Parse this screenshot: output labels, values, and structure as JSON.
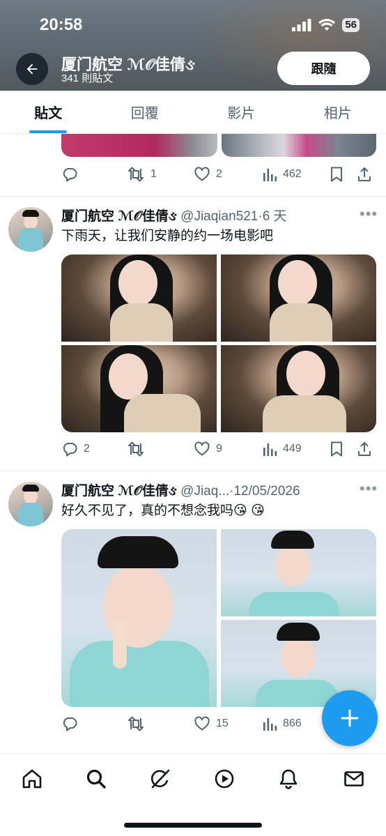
{
  "status_bar": {
    "time": "20:58",
    "battery": "56"
  },
  "header": {
    "name": "厦门航空 ℳ𝒪佳倩ઙ",
    "post_count": "341 則貼文",
    "follow_label": "跟隨"
  },
  "tabs": [
    {
      "label": "貼文",
      "active": true
    },
    {
      "label": "回覆",
      "active": false
    },
    {
      "label": "影片",
      "active": false
    },
    {
      "label": "相片",
      "active": false
    }
  ],
  "tweets": [
    {
      "stats": {
        "replies": "",
        "retweets": "1",
        "likes": "2",
        "views": "462"
      }
    },
    {
      "name": "厦门航空 ℳ𝒪佳倩ઙ",
      "handle": "@Jiaqian521",
      "separator": "·",
      "time": "6 天",
      "text": "下雨天，让我们安静的约一场电影吧",
      "stats": {
        "replies": "2",
        "retweets": "",
        "likes": "9",
        "views": "449"
      }
    },
    {
      "name": "厦门航空 ℳ𝒪佳倩ઙ",
      "handle": "@Jiaq...",
      "separator": "·",
      "time": "12/05/2026",
      "text": "好久不见了，真的不想念我吗😘 😘",
      "stats": {
        "replies": "",
        "retweets": "",
        "likes": "15",
        "views": "866"
      }
    }
  ],
  "colors": {
    "accent": "#1d9bf0",
    "text": "#0f1419",
    "muted": "#536471",
    "border": "#e7e9ea"
  },
  "icons": [
    "back-arrow-icon",
    "reply-icon",
    "retweet-icon",
    "like-icon",
    "views-icon",
    "bookmark-icon",
    "share-icon",
    "more-icon",
    "compose-plus-icon",
    "home-icon",
    "search-icon",
    "grok-icon",
    "video-icon",
    "notifications-icon",
    "messages-icon"
  ]
}
